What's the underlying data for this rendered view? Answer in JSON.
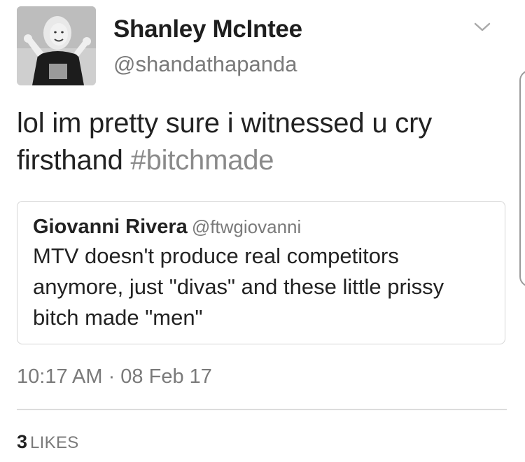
{
  "tweet": {
    "author": {
      "display_name": "Shanley McIntee",
      "handle": "@shandathapanda",
      "avatar_icon": "profile-photo"
    },
    "menu_icon": "chevron-down-icon",
    "text_main": "lol im pretty sure i witnessed u cry firsthand ",
    "hashtag": "#bitchmade",
    "quoted_tweet": {
      "display_name": "Giovanni Rivera",
      "handle": "@ftwgiovanni",
      "text": "MTV doesn't produce real competitors anymore, just \"divas\" and these little prissy bitch made \"men\""
    },
    "timestamp": "10:17 AM · 08 Feb 17",
    "likes": {
      "count": "3",
      "label": "LIKES"
    }
  },
  "colors": {
    "text": "#222222",
    "secondary": "#7a7a7a",
    "hashtag": "#8a8a8a",
    "border": "#d6d6d6"
  }
}
